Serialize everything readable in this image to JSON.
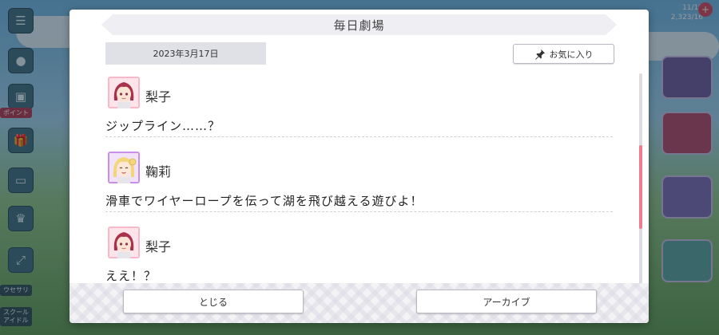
{
  "background": {
    "side_tag": "ポイント",
    "side_labels": [
      "ウセサリ",
      "スクール\nアイドル"
    ],
    "top_right": [
      "11/12",
      "2,323/16"
    ],
    "top_right_badge": "+"
  },
  "dialog": {
    "title": "毎日劇場",
    "date": "2023年3月17日",
    "favorite_label": "お気に入り",
    "entries": [
      {
        "speaker": "梨子",
        "avatar": "riko-avatar",
        "text": "ジップライン……？"
      },
      {
        "speaker": "鞠莉",
        "avatar": "mari-avatar",
        "text": "滑車でワイヤーロープを伝って湖を飛び越える遊びよ！"
      },
      {
        "speaker": "梨子",
        "avatar": "riko-avatar",
        "text": "ええ！？"
      }
    ],
    "close_label": "とじる",
    "archive_label": "アーカイブ"
  },
  "colors": {
    "accent_pink": "#f07c92",
    "title_bar": "#eeeef3",
    "date_chip": "#e0e0e7"
  }
}
